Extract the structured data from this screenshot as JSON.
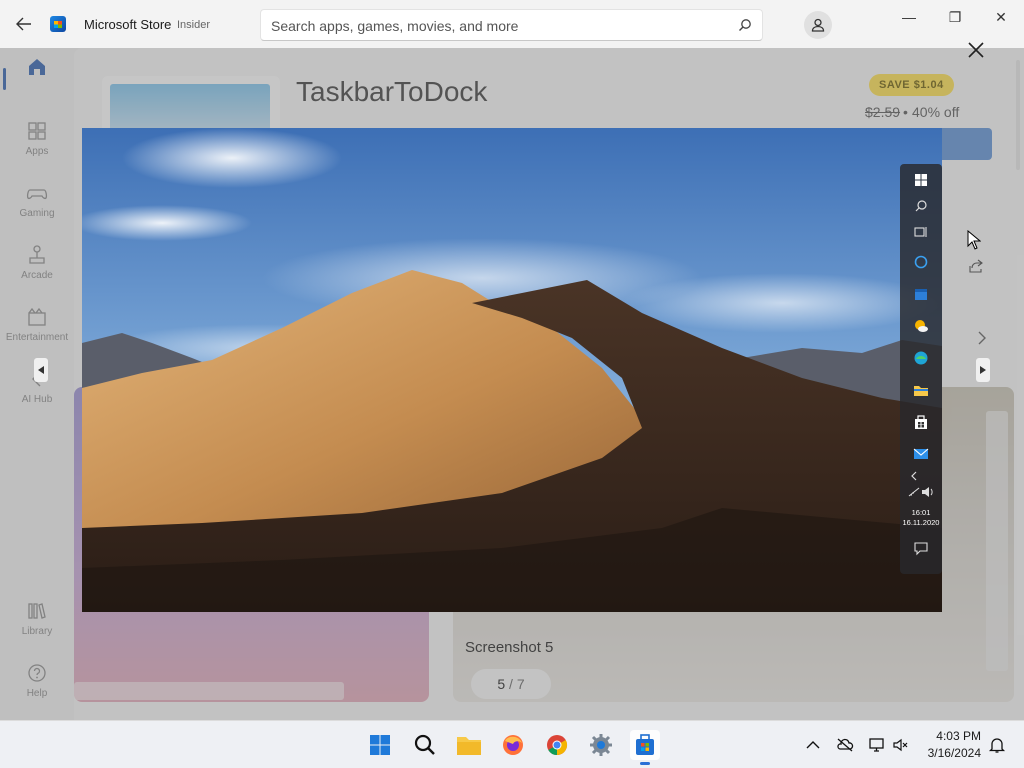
{
  "window": {
    "app_title": "Microsoft Store",
    "app_badge": "Insider",
    "minimize_glyph": "—",
    "maximize_glyph": "❐",
    "close_glyph": "✕"
  },
  "search": {
    "placeholder": "Search apps, games, movies, and more"
  },
  "sidebar": {
    "items": [
      {
        "label": "",
        "icon": "home-icon"
      },
      {
        "label": "Apps",
        "icon": "apps-icon"
      },
      {
        "label": "Gaming",
        "icon": "gamepad-icon"
      },
      {
        "label": "Arcade",
        "icon": "joystick-icon"
      },
      {
        "label": "Entertainment",
        "icon": "film-icon"
      },
      {
        "label": "AI Hub",
        "icon": "ai-icon"
      },
      {
        "label": "Library",
        "icon": "library-icon"
      },
      {
        "label": "Help",
        "icon": "help-icon"
      }
    ]
  },
  "product": {
    "name": "TaskbarToDock",
    "save_badge": "SAVE $1.04",
    "old_price": "$2.59",
    "separator": "•",
    "discount": "40% off"
  },
  "gallery": {
    "caption": "Screenshot 5",
    "current": "5",
    "separator": "/",
    "total": "7"
  },
  "screenshot_dock": {
    "time": "16:01",
    "date": "16.11.2020"
  },
  "taskbar": {
    "apps": [
      "windows-start-icon",
      "search-icon",
      "file-explorer-icon",
      "firefox-icon",
      "chrome-icon",
      "settings-icon",
      "microsoft-store-icon"
    ],
    "time": "4:03 PM",
    "date": "3/16/2024"
  },
  "colors": {
    "accent": "#2a5db0",
    "save_badge": "#ffe14a",
    "taskbar_bg": "#eef0f4"
  }
}
